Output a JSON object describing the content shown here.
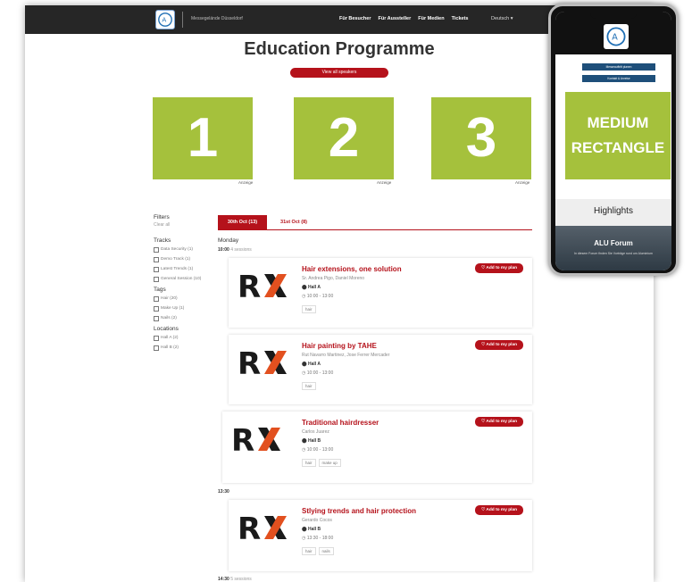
{
  "nav": {
    "subtitle": "Messegelände Düsseldorf",
    "links": [
      "Für Besucher",
      "Für Aussteller",
      "Für Medien",
      "Tickets"
    ],
    "language": "Deutsch ▾"
  },
  "page_title": "Education Programme",
  "speakers_button": "View all speakers",
  "ads": [
    {
      "number": "1",
      "label": "Anzeige"
    },
    {
      "number": "2",
      "label": "Anzeige"
    },
    {
      "number": "3",
      "label": "Anzeige"
    }
  ],
  "filters": {
    "heading": "Filters",
    "clear": "Clear all",
    "tracks_heading": "Tracks",
    "tracks": [
      "Data Security (1)",
      "Demo Track (1)",
      "Latest Trends (1)",
      "General Session (10)"
    ],
    "tags_heading": "Tags",
    "tags": [
      "Hair (20)",
      "Make Up (1)",
      "Nails (2)"
    ],
    "locations_heading": "Locations",
    "locations": [
      "Hall A (2)",
      "Hall B (2)"
    ]
  },
  "tabs": [
    "30th Oct (13)",
    "31st Oct (8)"
  ],
  "day": "Monday",
  "time_slots": [
    {
      "time": "10:00",
      "count": "4 sessions"
    },
    {
      "time": "13:30",
      "count": ""
    },
    {
      "time": "14:30",
      "count": "5 sessions"
    }
  ],
  "sessions": [
    {
      "title": "Hair extensions, one solution",
      "speakers": "Sr. Andrea Pigo, Daniel Moreno",
      "hall": "Hall A",
      "time": "10:00 - 13:00",
      "tags": [
        "hair"
      ],
      "plan": "Add to my plan"
    },
    {
      "title": "Hair painting by TAHE",
      "speakers": "Rut Navarro Martinez, Jose Ferrer Mercader",
      "hall": "Hall A",
      "time": "10:00 - 13:00",
      "tags": [
        "hair"
      ],
      "plan": "Add to my plan"
    },
    {
      "title": "Traditional hairdresser",
      "speakers": "Carlos Juarez",
      "hall": "Hall B",
      "time": "10:00 - 13:00",
      "tags": [
        "hair",
        "make up"
      ],
      "plan": "Add to my plan"
    },
    {
      "title": "Stlying trends and hair protection",
      "speakers": "Gerardo Cocos",
      "hall": "Hall B",
      "time": "13:30 - 18:00",
      "tags": [
        "hair",
        "nails"
      ],
      "plan": "Add to my plan"
    }
  ],
  "phone": {
    "links": [
      "Messeauftritt planen",
      "Kontakt & Anreise"
    ],
    "ad": "MEDIUM RECTANGLE",
    "highlights": "Highlights",
    "banner_title": "ALU Forum",
    "banner_sub": "In diesem Forum finden Sie Vorträge rund um Aluminium"
  },
  "colors": {
    "accent": "#b5121b",
    "ad_green": "#a5c13c",
    "nav": "#262626"
  }
}
